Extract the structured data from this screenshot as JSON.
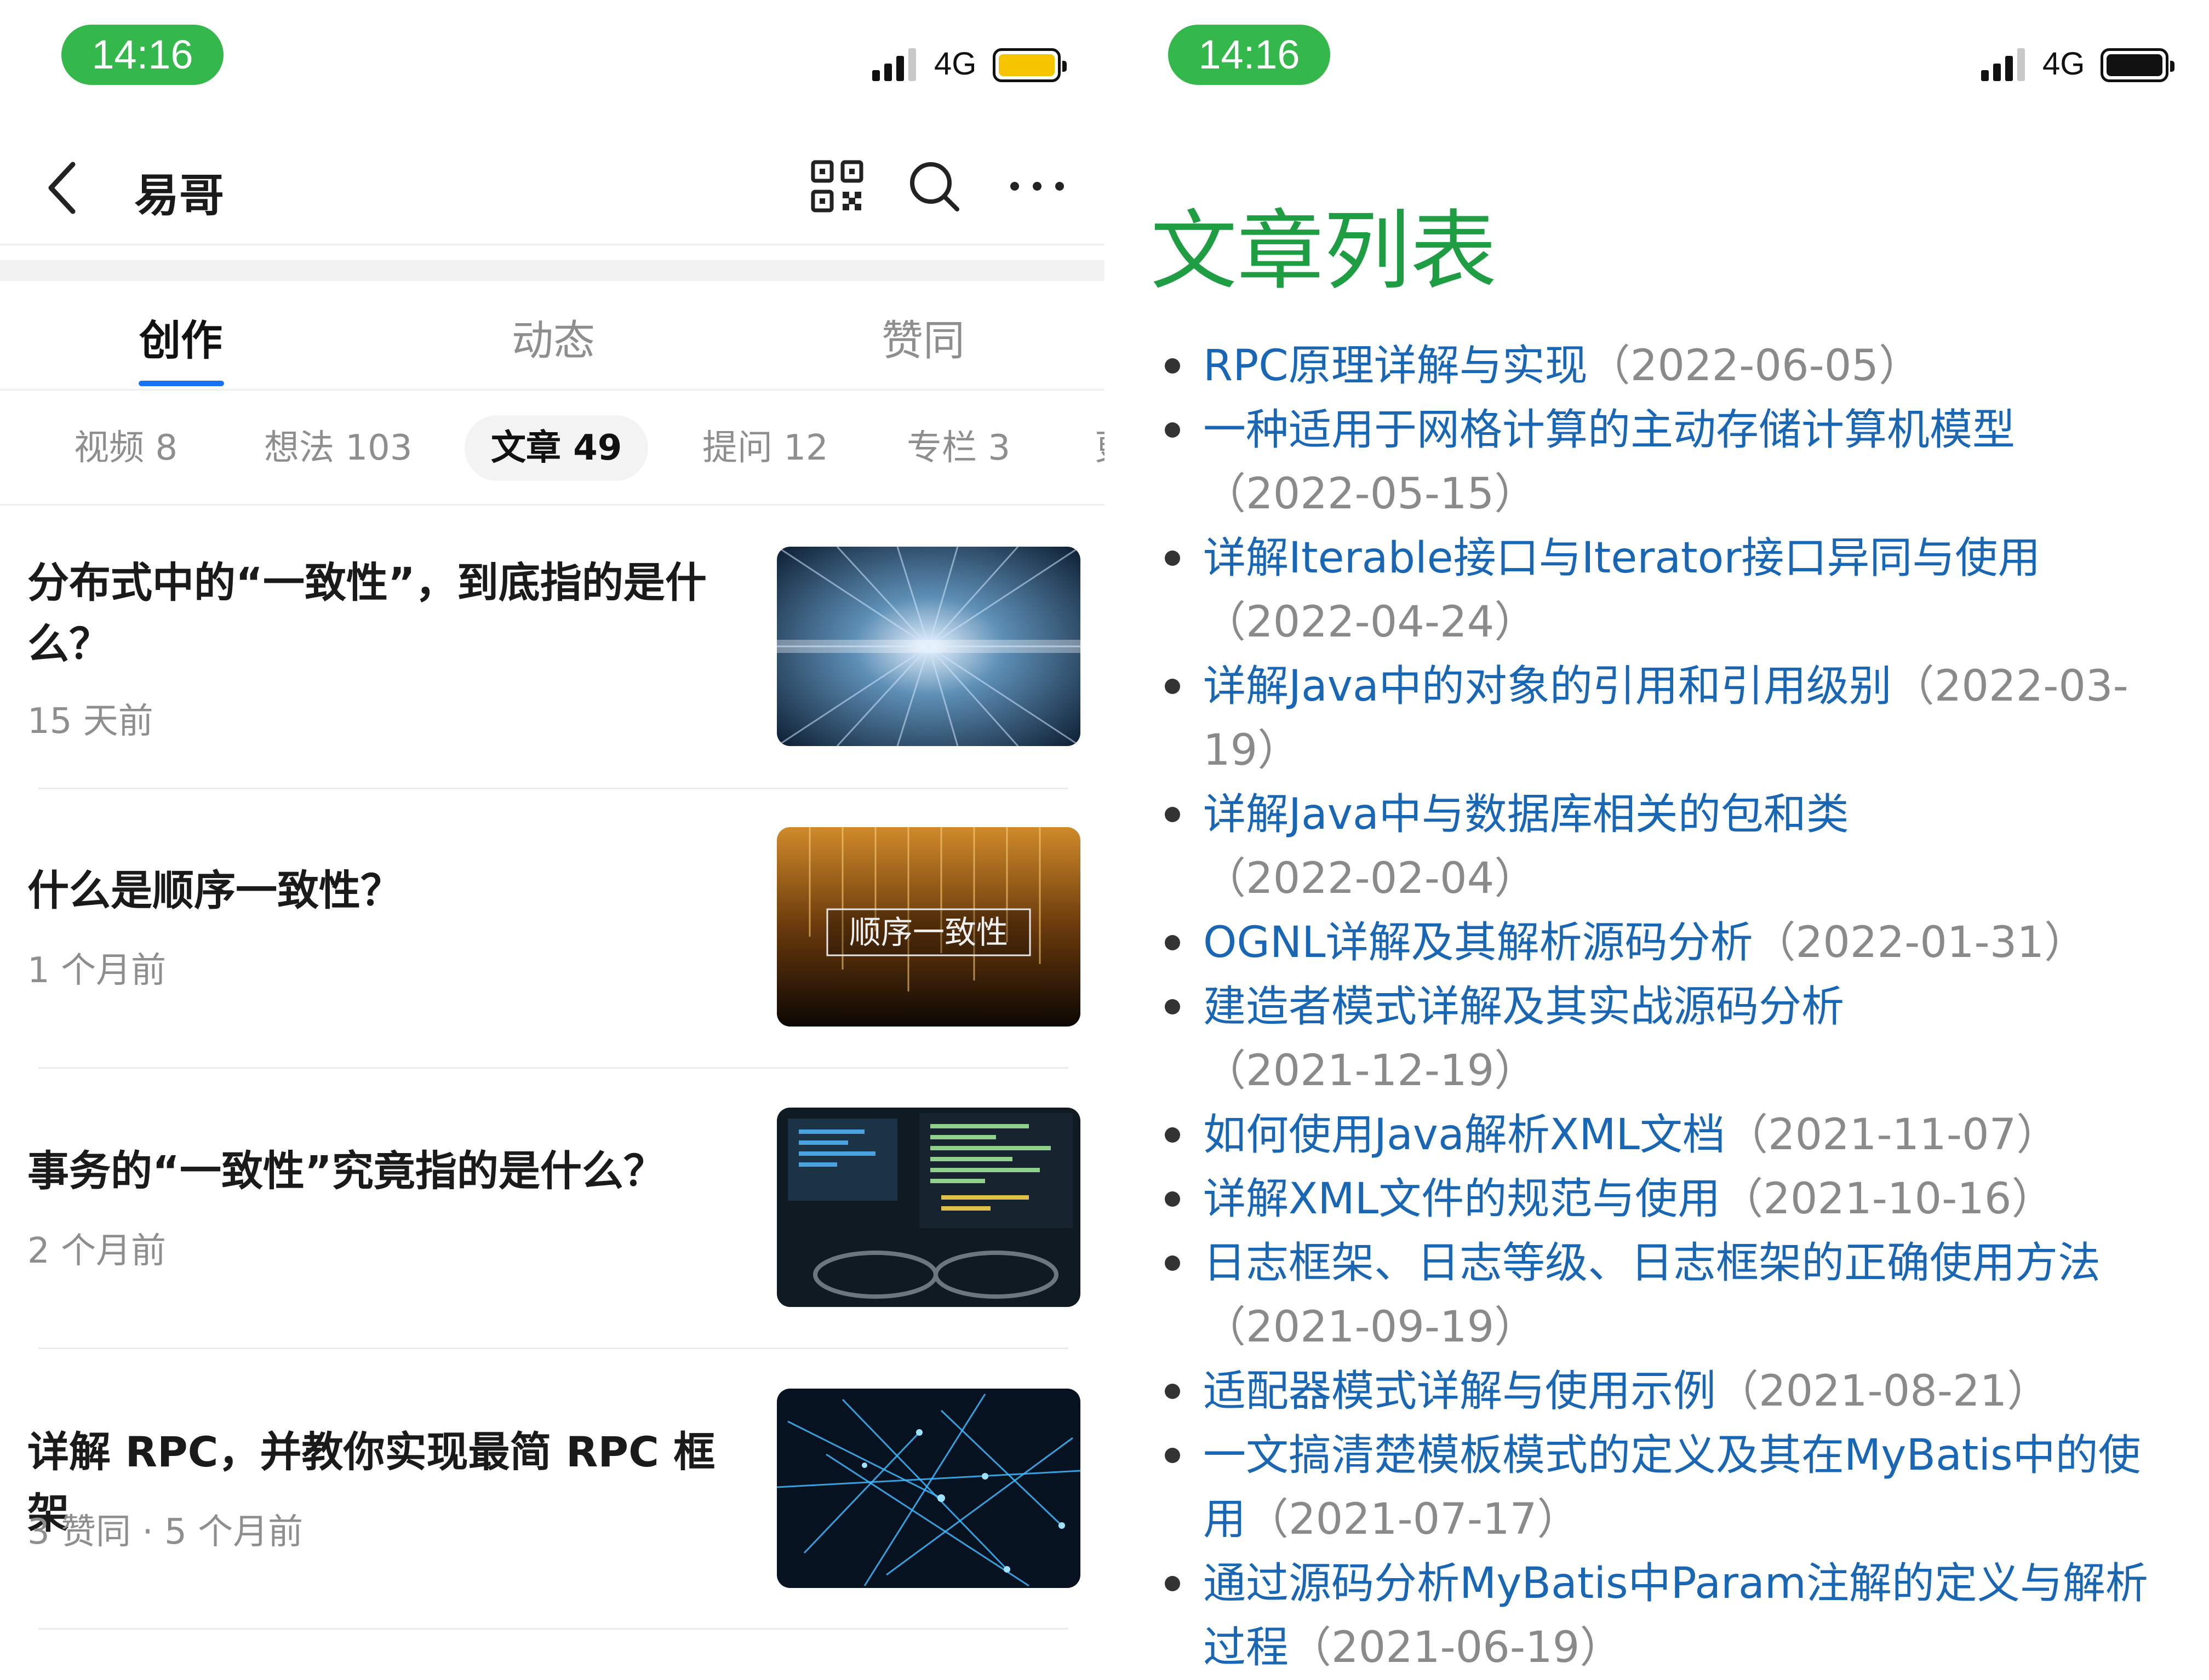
{
  "status": {
    "left_time": "14:16",
    "right_time": "14:16",
    "network": "4G",
    "left_battery_color": "#f5c400",
    "right_battery_color": "#111111"
  },
  "header": {
    "title": "易哥",
    "icons": [
      "back-icon",
      "qr-code-icon",
      "search-icon",
      "more-icon"
    ]
  },
  "main_tabs": [
    {
      "label": "创作",
      "active": true
    },
    {
      "label": "动态",
      "active": false
    },
    {
      "label": "赞同",
      "active": false
    }
  ],
  "sub_tabs": [
    {
      "label": "视频 8"
    },
    {
      "label": "想法 103"
    },
    {
      "label": "文章 49",
      "active": true
    },
    {
      "label": "提问 12"
    },
    {
      "label": "专栏 3"
    },
    {
      "label": "更"
    }
  ],
  "articles": [
    {
      "title": "分布式中的“一致性”，到底指的是什么？",
      "meta": "15 天前"
    },
    {
      "title": "什么是顺序一致性？",
      "meta": "1 个月前",
      "thumb_text": "顺序一致性"
    },
    {
      "title": "事务的“一致性”究竟指的是什么？",
      "meta": "2 个月前"
    },
    {
      "title": "详解 RPC，并教你实现最简 RPC 框架",
      "meta": "3 赞同 · 5 个月前"
    }
  ],
  "article_list": {
    "heading": "文章列表",
    "items": [
      {
        "title": "RPC原理详解与实现",
        "date": "（2022-06-05）"
      },
      {
        "title": "一种适用于网格计算的主动存储计算机模型",
        "date": "（2022-05-15）"
      },
      {
        "title": "详解Iterable接口与Iterator接口异同与使用",
        "date": "（2022-04-24）"
      },
      {
        "title": "详解Java中的对象的引用和引用级别",
        "date": "（2022-03-19）"
      },
      {
        "title": "详解Java中与数据库相关的包和类",
        "date": "（2022-02-04）"
      },
      {
        "title": "OGNL详解及其解析源码分析",
        "date": "（2022-01-31）"
      },
      {
        "title": "建造者模式详解及其实战源码分析",
        "date": "（2021-12-19）"
      },
      {
        "title": "如何使用Java解析XML文档",
        "date": "（2021-11-07）"
      },
      {
        "title": "详解XML文件的规范与使用",
        "date": "（2021-10-16）"
      },
      {
        "title": "日志框架、日志等级、日志框架的正确使用方法",
        "date": "（2021-09-19）"
      },
      {
        "title": "适配器模式详解与使用示例",
        "date": "（2021-08-21）"
      },
      {
        "title": "一文搞清楚模板模式的定义及其在MyBatis中的使用",
        "date": "（2021-07-17）"
      },
      {
        "title": "通过源码分析MyBatis中Param注解的定义与解析过程",
        "date": "（2021-06-19）"
      }
    ]
  }
}
